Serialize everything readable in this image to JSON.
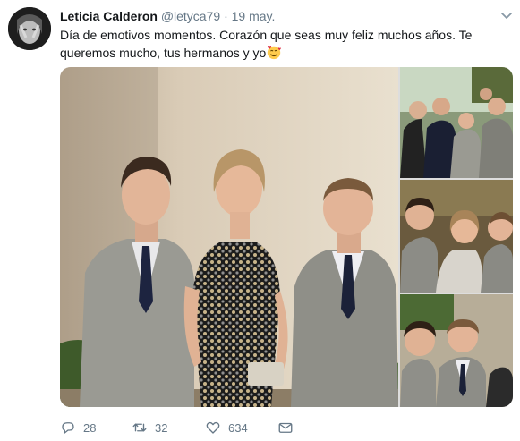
{
  "tweet": {
    "author_name": "Leticia Calderon",
    "author_handle": "@letyca79",
    "separator": "·",
    "date": "19 may.",
    "text": "Día de emotivos momentos. Corazón que seas muy feliz muchos años. Te queremos mucho, tus hermanos y yo",
    "emoji": "smiling-face-with-hearts"
  },
  "media": {
    "count": 4,
    "items": [
      "main-photo",
      "thumb-top",
      "thumb-middle",
      "thumb-bottom"
    ]
  },
  "actions": {
    "replies": "28",
    "retweets": "32",
    "likes": "634"
  },
  "icons": {
    "reply": "reply-icon",
    "retweet": "retweet-icon",
    "like": "heart-icon",
    "dm": "mail-icon",
    "menu": "chevron-down-icon"
  },
  "colors": {
    "text": "#14171a",
    "secondary": "#657786",
    "background": "#ffffff"
  }
}
